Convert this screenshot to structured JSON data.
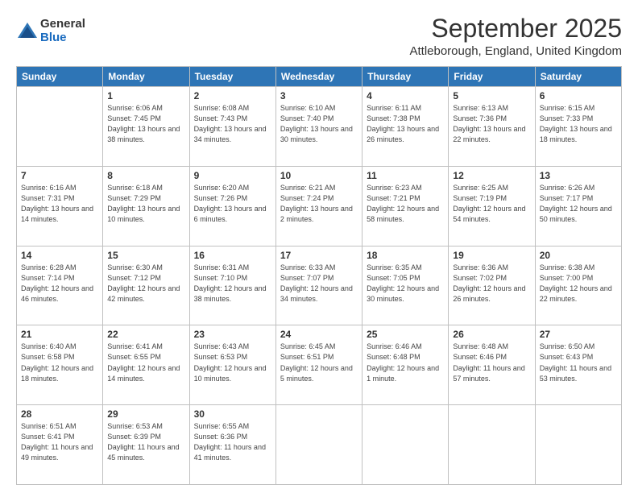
{
  "logo": {
    "general": "General",
    "blue": "Blue"
  },
  "title": "September 2025",
  "location": "Attleborough, England, United Kingdom",
  "days_of_week": [
    "Sunday",
    "Monday",
    "Tuesday",
    "Wednesday",
    "Thursday",
    "Friday",
    "Saturday"
  ],
  "weeks": [
    [
      {
        "day": "",
        "sunrise": "",
        "sunset": "",
        "daylight": ""
      },
      {
        "day": "1",
        "sunrise": "Sunrise: 6:06 AM",
        "sunset": "Sunset: 7:45 PM",
        "daylight": "Daylight: 13 hours and 38 minutes."
      },
      {
        "day": "2",
        "sunrise": "Sunrise: 6:08 AM",
        "sunset": "Sunset: 7:43 PM",
        "daylight": "Daylight: 13 hours and 34 minutes."
      },
      {
        "day": "3",
        "sunrise": "Sunrise: 6:10 AM",
        "sunset": "Sunset: 7:40 PM",
        "daylight": "Daylight: 13 hours and 30 minutes."
      },
      {
        "day": "4",
        "sunrise": "Sunrise: 6:11 AM",
        "sunset": "Sunset: 7:38 PM",
        "daylight": "Daylight: 13 hours and 26 minutes."
      },
      {
        "day": "5",
        "sunrise": "Sunrise: 6:13 AM",
        "sunset": "Sunset: 7:36 PM",
        "daylight": "Daylight: 13 hours and 22 minutes."
      },
      {
        "day": "6",
        "sunrise": "Sunrise: 6:15 AM",
        "sunset": "Sunset: 7:33 PM",
        "daylight": "Daylight: 13 hours and 18 minutes."
      }
    ],
    [
      {
        "day": "7",
        "sunrise": "Sunrise: 6:16 AM",
        "sunset": "Sunset: 7:31 PM",
        "daylight": "Daylight: 13 hours and 14 minutes."
      },
      {
        "day": "8",
        "sunrise": "Sunrise: 6:18 AM",
        "sunset": "Sunset: 7:29 PM",
        "daylight": "Daylight: 13 hours and 10 minutes."
      },
      {
        "day": "9",
        "sunrise": "Sunrise: 6:20 AM",
        "sunset": "Sunset: 7:26 PM",
        "daylight": "Daylight: 13 hours and 6 minutes."
      },
      {
        "day": "10",
        "sunrise": "Sunrise: 6:21 AM",
        "sunset": "Sunset: 7:24 PM",
        "daylight": "Daylight: 13 hours and 2 minutes."
      },
      {
        "day": "11",
        "sunrise": "Sunrise: 6:23 AM",
        "sunset": "Sunset: 7:21 PM",
        "daylight": "Daylight: 12 hours and 58 minutes."
      },
      {
        "day": "12",
        "sunrise": "Sunrise: 6:25 AM",
        "sunset": "Sunset: 7:19 PM",
        "daylight": "Daylight: 12 hours and 54 minutes."
      },
      {
        "day": "13",
        "sunrise": "Sunrise: 6:26 AM",
        "sunset": "Sunset: 7:17 PM",
        "daylight": "Daylight: 12 hours and 50 minutes."
      }
    ],
    [
      {
        "day": "14",
        "sunrise": "Sunrise: 6:28 AM",
        "sunset": "Sunset: 7:14 PM",
        "daylight": "Daylight: 12 hours and 46 minutes."
      },
      {
        "day": "15",
        "sunrise": "Sunrise: 6:30 AM",
        "sunset": "Sunset: 7:12 PM",
        "daylight": "Daylight: 12 hours and 42 minutes."
      },
      {
        "day": "16",
        "sunrise": "Sunrise: 6:31 AM",
        "sunset": "Sunset: 7:10 PM",
        "daylight": "Daylight: 12 hours and 38 minutes."
      },
      {
        "day": "17",
        "sunrise": "Sunrise: 6:33 AM",
        "sunset": "Sunset: 7:07 PM",
        "daylight": "Daylight: 12 hours and 34 minutes."
      },
      {
        "day": "18",
        "sunrise": "Sunrise: 6:35 AM",
        "sunset": "Sunset: 7:05 PM",
        "daylight": "Daylight: 12 hours and 30 minutes."
      },
      {
        "day": "19",
        "sunrise": "Sunrise: 6:36 AM",
        "sunset": "Sunset: 7:02 PM",
        "daylight": "Daylight: 12 hours and 26 minutes."
      },
      {
        "day": "20",
        "sunrise": "Sunrise: 6:38 AM",
        "sunset": "Sunset: 7:00 PM",
        "daylight": "Daylight: 12 hours and 22 minutes."
      }
    ],
    [
      {
        "day": "21",
        "sunrise": "Sunrise: 6:40 AM",
        "sunset": "Sunset: 6:58 PM",
        "daylight": "Daylight: 12 hours and 18 minutes."
      },
      {
        "day": "22",
        "sunrise": "Sunrise: 6:41 AM",
        "sunset": "Sunset: 6:55 PM",
        "daylight": "Daylight: 12 hours and 14 minutes."
      },
      {
        "day": "23",
        "sunrise": "Sunrise: 6:43 AM",
        "sunset": "Sunset: 6:53 PM",
        "daylight": "Daylight: 12 hours and 10 minutes."
      },
      {
        "day": "24",
        "sunrise": "Sunrise: 6:45 AM",
        "sunset": "Sunset: 6:51 PM",
        "daylight": "Daylight: 12 hours and 5 minutes."
      },
      {
        "day": "25",
        "sunrise": "Sunrise: 6:46 AM",
        "sunset": "Sunset: 6:48 PM",
        "daylight": "Daylight: 12 hours and 1 minute."
      },
      {
        "day": "26",
        "sunrise": "Sunrise: 6:48 AM",
        "sunset": "Sunset: 6:46 PM",
        "daylight": "Daylight: 11 hours and 57 minutes."
      },
      {
        "day": "27",
        "sunrise": "Sunrise: 6:50 AM",
        "sunset": "Sunset: 6:43 PM",
        "daylight": "Daylight: 11 hours and 53 minutes."
      }
    ],
    [
      {
        "day": "28",
        "sunrise": "Sunrise: 6:51 AM",
        "sunset": "Sunset: 6:41 PM",
        "daylight": "Daylight: 11 hours and 49 minutes."
      },
      {
        "day": "29",
        "sunrise": "Sunrise: 6:53 AM",
        "sunset": "Sunset: 6:39 PM",
        "daylight": "Daylight: 11 hours and 45 minutes."
      },
      {
        "day": "30",
        "sunrise": "Sunrise: 6:55 AM",
        "sunset": "Sunset: 6:36 PM",
        "daylight": "Daylight: 11 hours and 41 minutes."
      },
      {
        "day": "",
        "sunrise": "",
        "sunset": "",
        "daylight": ""
      },
      {
        "day": "",
        "sunrise": "",
        "sunset": "",
        "daylight": ""
      },
      {
        "day": "",
        "sunrise": "",
        "sunset": "",
        "daylight": ""
      },
      {
        "day": "",
        "sunrise": "",
        "sunset": "",
        "daylight": ""
      }
    ]
  ]
}
